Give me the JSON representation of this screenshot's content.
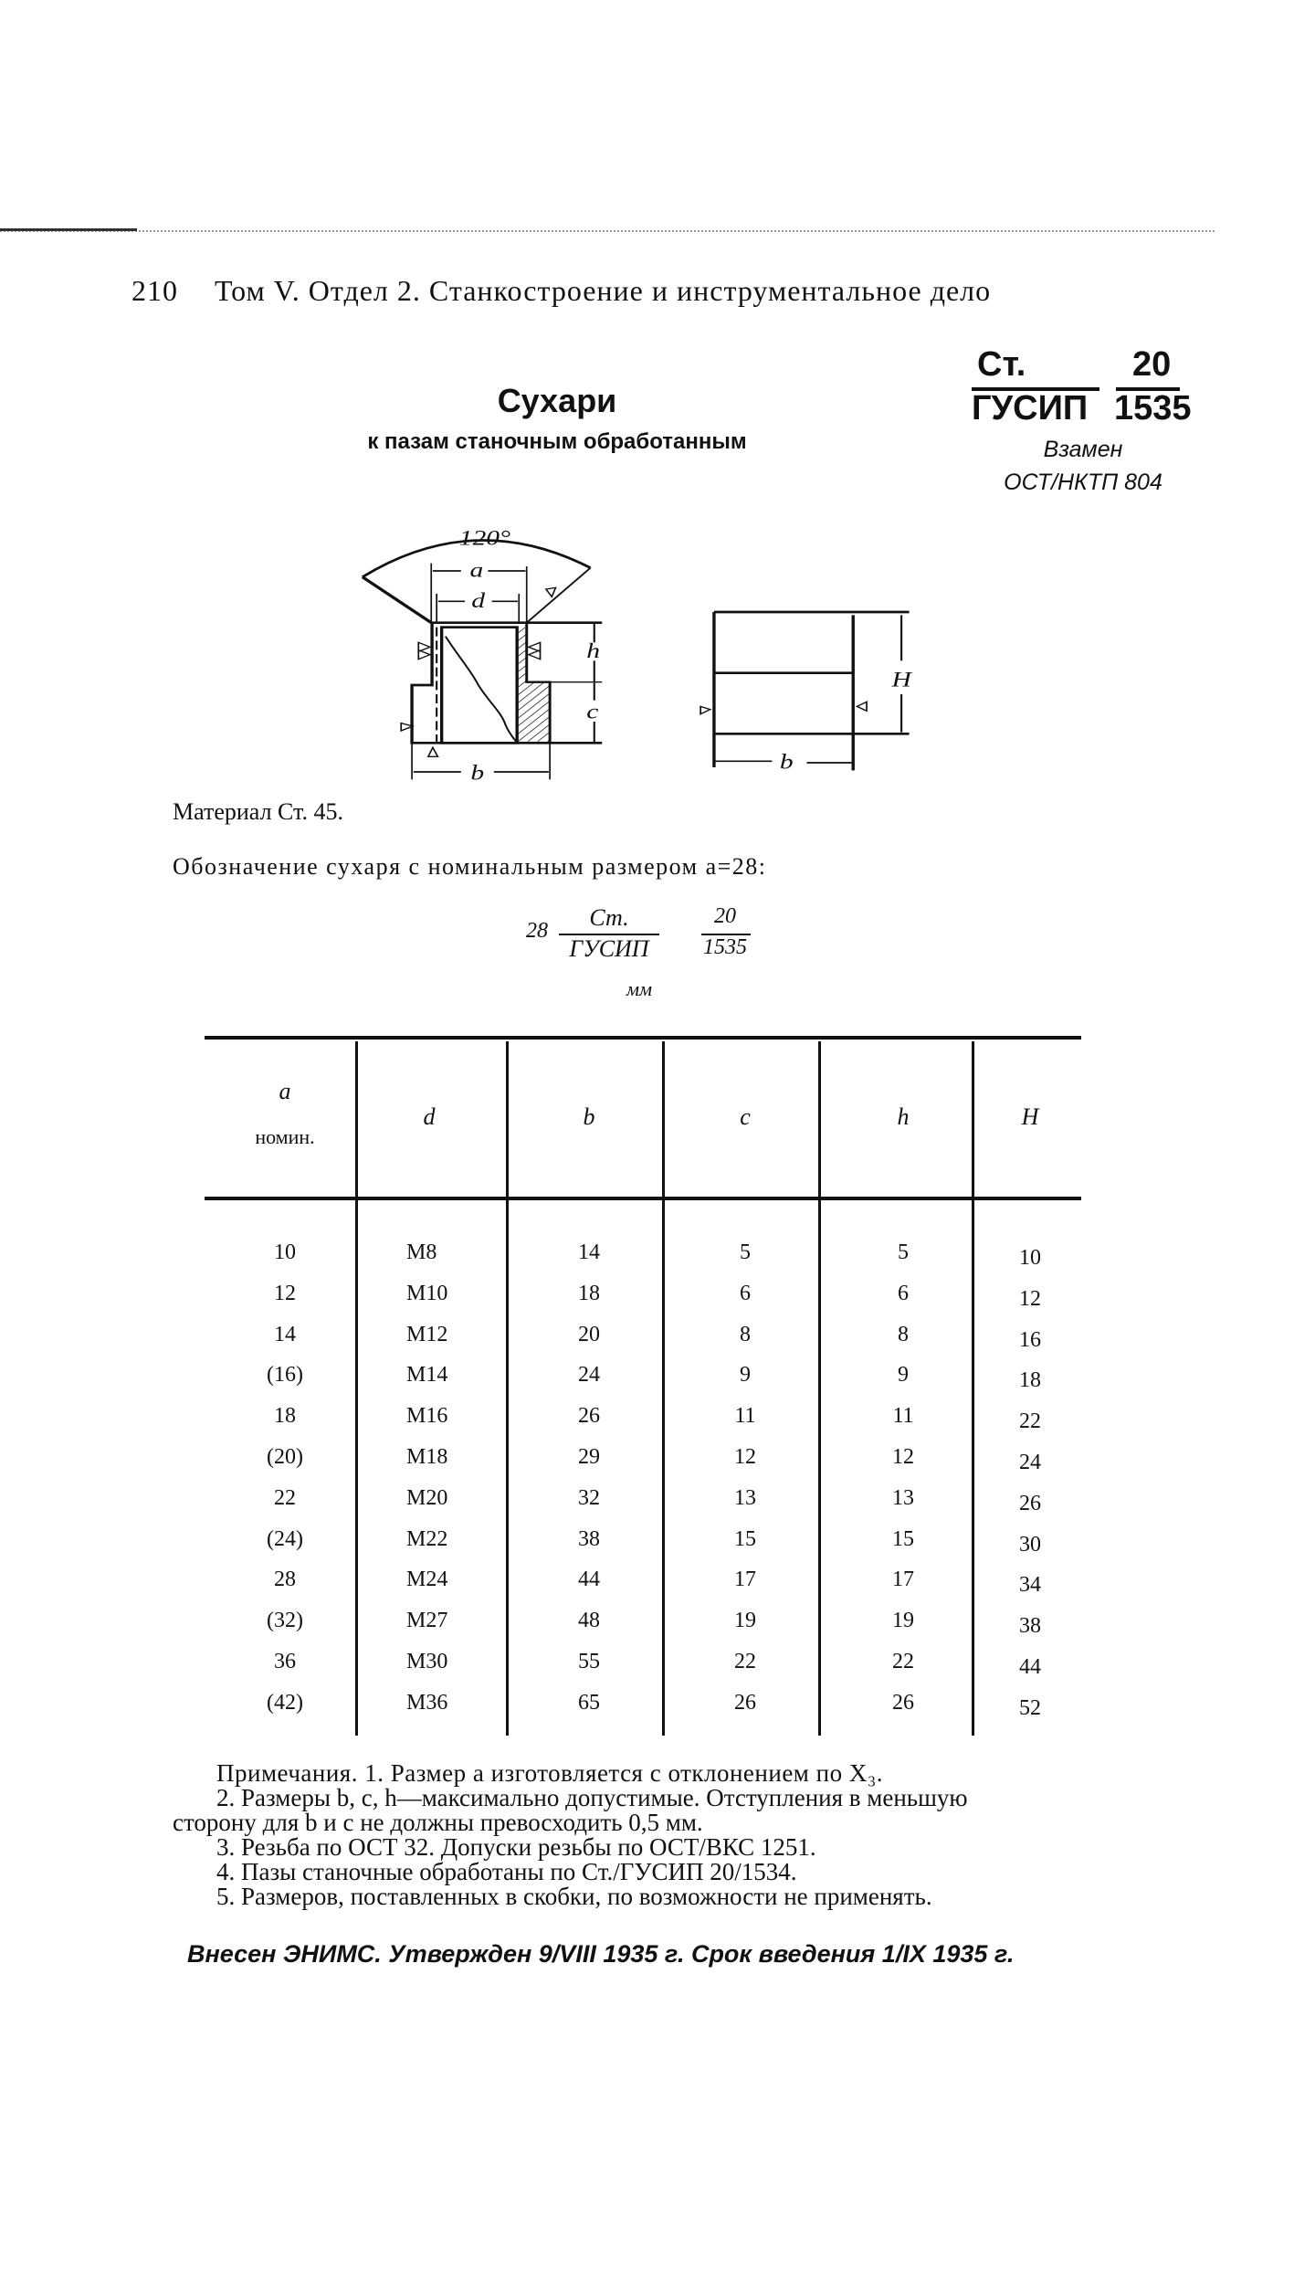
{
  "header": {
    "page_number": "210",
    "running_title": "Том V. Отдел 2. Станкостроение и инструментальное дело"
  },
  "standard": {
    "numerator_left": "Ст.",
    "numerator_right": "20",
    "denominator_left": "ГУСИП",
    "denominator_right": "1535",
    "replaces_label": "Взамен",
    "replaces_value": "ОСТ/НКТП 804"
  },
  "title": "Сухари",
  "subtitle": "к пазам станочным обработанным",
  "drawing": {
    "angle_label": "120°",
    "dim_a": "a",
    "dim_d": "d",
    "dim_h": "h",
    "dim_c": "c",
    "dim_b": "b",
    "dim_H": "H",
    "dim_b2": "b"
  },
  "material": "Материал Ст. 45.",
  "designation_text": "Обозначение сухаря с номинальным размером a=28:",
  "designation_example": {
    "prefix": "28",
    "num_left": "Ст.",
    "den_left": "ГУСИП",
    "num_right": "20",
    "den_right": "1535"
  },
  "units": "мм",
  "table": {
    "headers": [
      {
        "top": "a",
        "bottom": "номин."
      },
      {
        "top": "d"
      },
      {
        "top": "b"
      },
      {
        "top": "c"
      },
      {
        "top": "h"
      },
      {
        "top": "H"
      }
    ],
    "rows": [
      [
        "10",
        "M8",
        "14",
        "5",
        "5",
        "10"
      ],
      [
        "12",
        "M10",
        "18",
        "6",
        "6",
        "12"
      ],
      [
        "14",
        "M12",
        "20",
        "8",
        "8",
        "16"
      ],
      [
        "(16)",
        "M14",
        "24",
        "9",
        "9",
        "18"
      ],
      [
        "18",
        "M16",
        "26",
        "11",
        "11",
        "22"
      ],
      [
        "(20)",
        "M18",
        "29",
        "12",
        "12",
        "24"
      ],
      [
        "22",
        "M20",
        "32",
        "13",
        "13",
        "26"
      ],
      [
        "(24)",
        "M22",
        "38",
        "15",
        "15",
        "30"
      ],
      [
        "28",
        "M24",
        "44",
        "17",
        "17",
        "34"
      ],
      [
        "(32)",
        "M27",
        "48",
        "19",
        "19",
        "38"
      ],
      [
        "36",
        "M30",
        "55",
        "22",
        "22",
        "44"
      ],
      [
        "(42)",
        "M36",
        "65",
        "26",
        "26",
        "52"
      ]
    ]
  },
  "notes": [
    "Примечания. 1. Размер a изготовляется с отклонением по X₃.",
    "2. Размеры b, c, h—максимально допустимые. Отступления в меньшую",
    "сторону для b и c не должны превосходить 0,5 мм.",
    "3. Резьба по ОСТ 32. Допуски резьбы по ОСТ/ВКС 1251.",
    "4. Пазы станочные обработаны по Ст./ГУСИП 20/1534.",
    "5. Размеров, поставленных в скобки, по возможности не применять."
  ],
  "footer": "Внесен ЭНИМС. Утвержден 9/VIII 1935 г.  Срок введения 1/IX 1935 г."
}
